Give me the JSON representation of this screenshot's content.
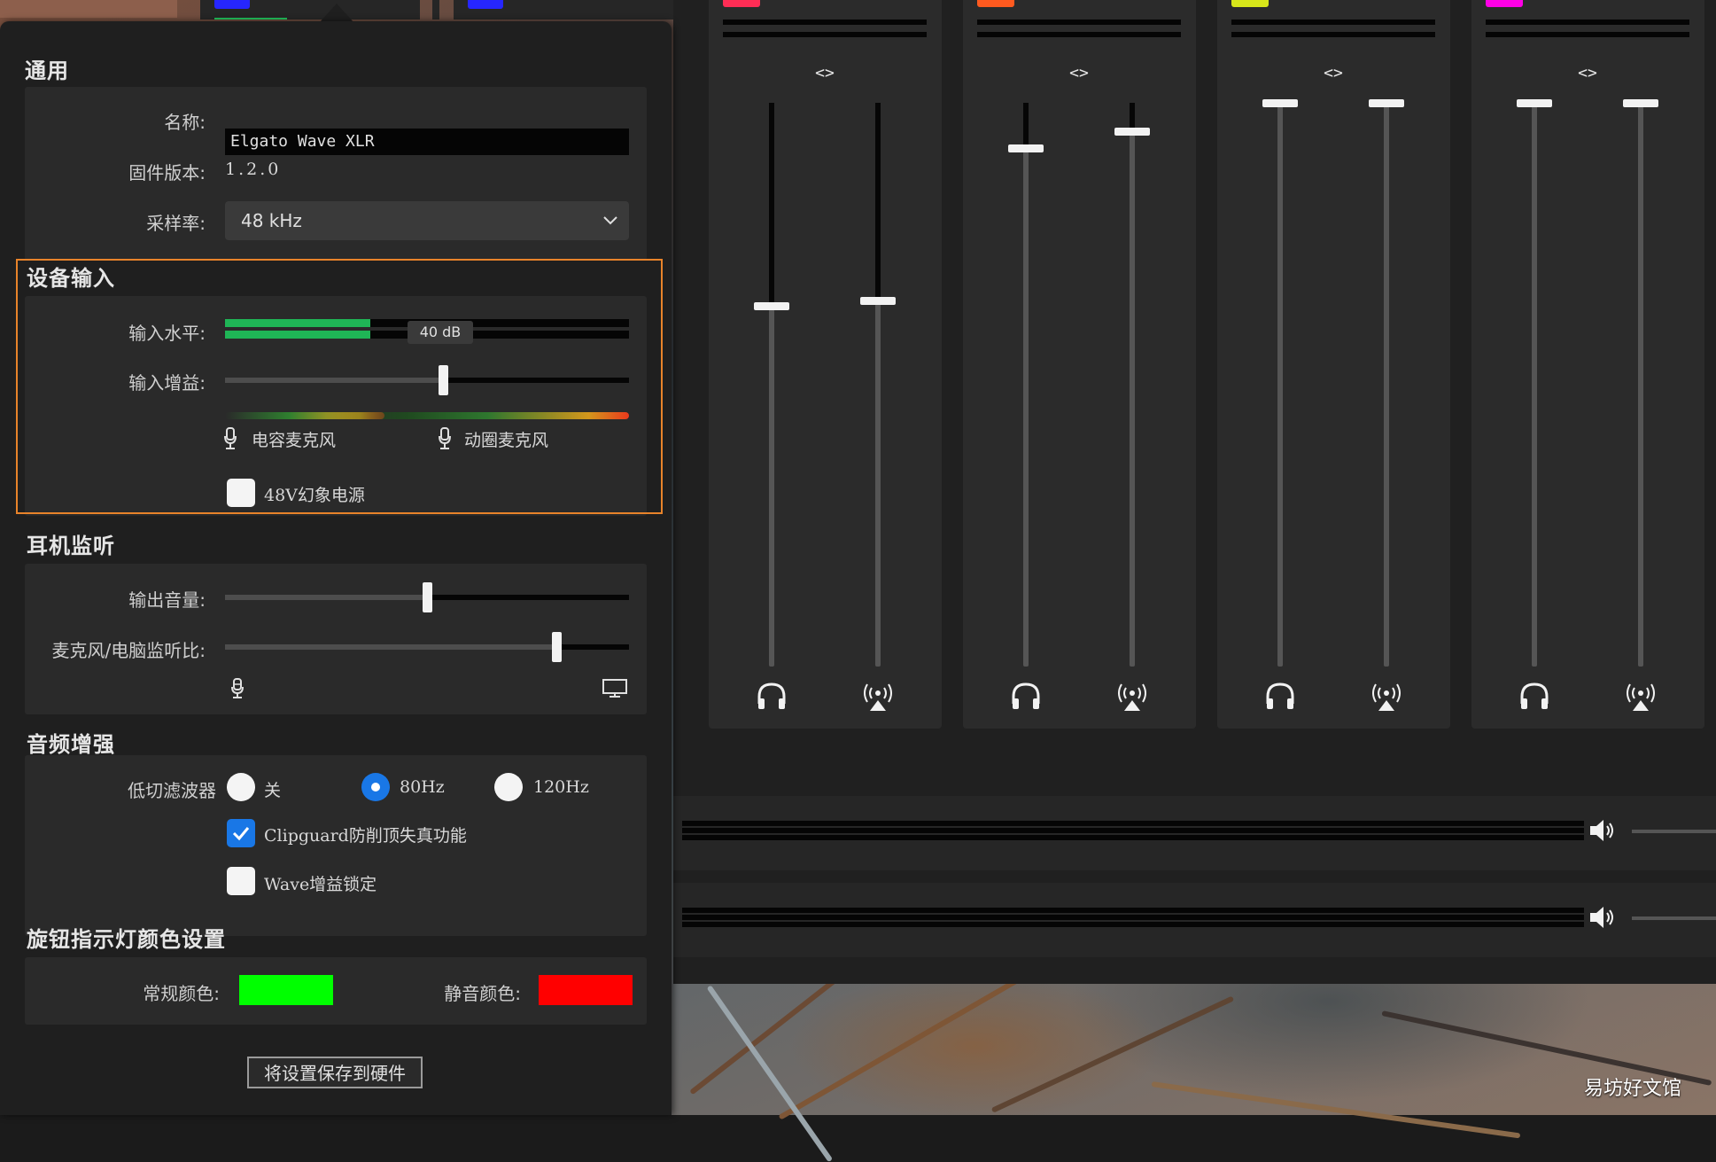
{
  "general": {
    "title": "通用",
    "name_label": "名称:",
    "name_value": "Elgato Wave XLR",
    "firmware_label": "固件版本:",
    "firmware_value": "1.2.0",
    "sample_rate_label": "采样率:",
    "sample_rate_value": "48 kHz"
  },
  "device_input": {
    "title": "设备输入",
    "input_level_label": "输入水平:",
    "input_level_tooltip": "40 dB",
    "input_level_fraction": 0.36,
    "input_gain_label": "输入增益:",
    "input_gain_fraction": 0.54,
    "condenser_mic_label": "电容麦克风",
    "dynamic_mic_label": "动圈麦克风",
    "phantom_power_label": "48V幻象电源",
    "phantom_power_checked": false
  },
  "headphone_monitor": {
    "title": "耳机监听",
    "output_volume_label": "输出音量:",
    "output_volume_fraction": 0.5,
    "mic_pc_mix_label": "麦克风/电脑监听比:",
    "mic_pc_mix_fraction": 0.82
  },
  "audio_enhance": {
    "title": "音频增强",
    "low_cut_label": "低切滤波器",
    "low_cut_options": [
      "关",
      "80Hz",
      "120Hz"
    ],
    "low_cut_selected": "80Hz",
    "clipguard_label": "Clipguard防削顶失真功能",
    "clipguard_checked": true,
    "wave_gain_lock_label": "Wave增益锁定",
    "wave_gain_lock_checked": false
  },
  "knob_led": {
    "title": "旋钮指示灯颜色设置",
    "normal_color_label": "常规颜色:",
    "normal_color": "#00ff00",
    "mute_color_label": "静音颜色:",
    "mute_color": "#ff0000"
  },
  "save_button_label": "将设置保存到硬件",
  "mixer": {
    "channels": [
      {
        "color": "#ff2d55",
        "monitor_level": 0.64,
        "stream_level": 0.65
      },
      {
        "color": "#ff5a1f",
        "monitor_level": 0.92,
        "stream_level": 0.95
      },
      {
        "color": "#d7e61a",
        "monitor_level": 1.0,
        "stream_level": 1.0
      },
      {
        "color": "#ff00e6",
        "monitor_level": 1.0,
        "stream_level": 1.0
      }
    ],
    "tab_colors": [
      "#22c55e",
      "#2626ff",
      "#2626ff"
    ]
  },
  "watermark": "易坊好文馆"
}
